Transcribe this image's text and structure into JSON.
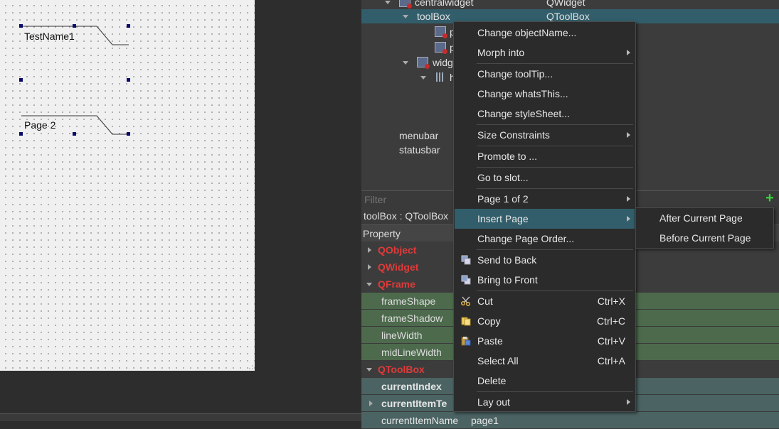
{
  "form": {
    "page1_label": "TestName1",
    "page2_label": "Page 2"
  },
  "object_tree": {
    "rows": [
      {
        "name": "centralwidget",
        "class": "QWidget"
      },
      {
        "name": "toolBox",
        "class": "QToolBox"
      },
      {
        "name": "p",
        "class": ""
      },
      {
        "name": "p",
        "class": ""
      },
      {
        "name": "widg",
        "class": ""
      },
      {
        "name": "h",
        "class": ""
      },
      {
        "name": "menubar",
        "class": ""
      },
      {
        "name": "statusbar",
        "class": ""
      }
    ]
  },
  "filter": {
    "placeholder": "Filter"
  },
  "object_class_label": "toolBox : QToolBox",
  "property_header": "Property",
  "properties": [
    {
      "name": "QObject"
    },
    {
      "name": "QWidget"
    },
    {
      "name": "QFrame"
    },
    {
      "name": "frameShape"
    },
    {
      "name": "frameShadow"
    },
    {
      "name": "lineWidth"
    },
    {
      "name": "midLineWidth"
    },
    {
      "name": "QToolBox"
    },
    {
      "name": "currentIndex"
    },
    {
      "name": "currentItemTe"
    },
    {
      "name": "currentItemName",
      "value": "page1"
    }
  ],
  "context_menu": {
    "items": [
      {
        "label": "Change objectName..."
      },
      {
        "label": "Morph into"
      },
      {
        "label": "Change toolTip..."
      },
      {
        "label": "Change whatsThis..."
      },
      {
        "label": "Change styleSheet..."
      },
      {
        "label": "Size Constraints"
      },
      {
        "label": "Promote to ..."
      },
      {
        "label": "Go to slot..."
      },
      {
        "label": "Page 1 of 2"
      },
      {
        "label": "Insert Page"
      },
      {
        "label": "Change Page Order..."
      },
      {
        "label": "Send to Back"
      },
      {
        "label": "Bring to Front"
      },
      {
        "label": "Cut",
        "shortcut": "Ctrl+X"
      },
      {
        "label": "Copy",
        "shortcut": "Ctrl+C"
      },
      {
        "label": "Paste",
        "shortcut": "Ctrl+V"
      },
      {
        "label": "Select All",
        "shortcut": "Ctrl+A"
      },
      {
        "label": "Delete"
      },
      {
        "label": "Lay out"
      }
    ]
  },
  "submenu": {
    "items": [
      {
        "label": "After Current Page"
      },
      {
        "label": "Before Current Page"
      }
    ]
  },
  "colors": {
    "selection": "#325e6b",
    "category_text": "#e03a3a",
    "frame_rows": "#4d6a4d",
    "toolbox_rows": "#4b6363",
    "add_button": "#37d237"
  },
  "icons": {
    "add": "plus-icon",
    "cut": "scissors-icon",
    "copy": "copy-icon",
    "paste": "paste-icon",
    "send_back": "send-to-back-icon",
    "bring_front": "bring-to-front-icon"
  }
}
